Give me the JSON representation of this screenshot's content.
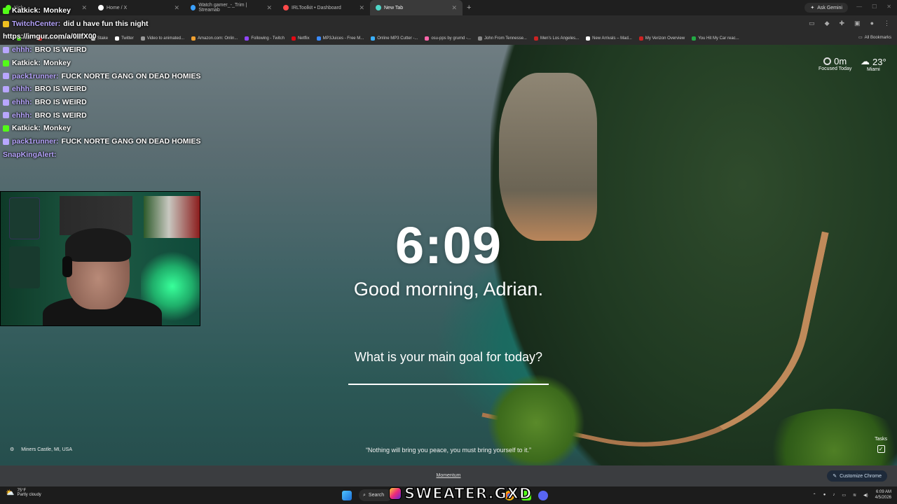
{
  "browser": {
    "tabs": [
      {
        "label": "Kick",
        "color": "#53fc18",
        "active": false
      },
      {
        "label": "Home / X",
        "color": "#ffffff",
        "active": false
      },
      {
        "label": "Watch gamer_-_Trim | Streamab",
        "color": "#3aa0ff",
        "active": false
      },
      {
        "label": "IRLToolkit • Dashboard",
        "color": "#ff4a4a",
        "active": false
      },
      {
        "label": "New Tab",
        "color": "#4fd6c8",
        "active": true
      }
    ],
    "new_tab_symbol": "+",
    "ask_gemini": "Ask Gemini",
    "bookmarks": [
      {
        "label": "Kick",
        "color": "#53fc18"
      },
      {
        "label": "Subscriptions - You...",
        "color": "#ff3b3b"
      },
      {
        "label": "Stake",
        "color": "#dddddd"
      },
      {
        "label": "Twitter",
        "color": "#ffffff"
      },
      {
        "label": "Video to animated...",
        "color": "#999999"
      },
      {
        "label": "Amazon.com: Onlin...",
        "color": "#f0a030"
      },
      {
        "label": "Following - Twitch",
        "color": "#9146ff"
      },
      {
        "label": "Netflix",
        "color": "#e50914"
      },
      {
        "label": "MP3Juices - Free M...",
        "color": "#3a8bff"
      },
      {
        "label": "Online MP3 Cutter -...",
        "color": "#3ab0ff"
      },
      {
        "label": "osu-pps by grumd -...",
        "color": "#ff66aa"
      },
      {
        "label": "John From Tennesse...",
        "color": "#888888"
      },
      {
        "label": "Men's Los Angeles...",
        "color": "#cc2222"
      },
      {
        "label": "New Arrivals – Mad...",
        "color": "#ffffff"
      },
      {
        "label": "My Verizon Overview",
        "color": "#cc2222"
      },
      {
        "label": "You Hit My Car reac...",
        "color": "#22aa44"
      }
    ],
    "all_bookmarks": "All Bookmarks"
  },
  "momentum": {
    "time": "6:09",
    "greeting": "Good morning, Adrian.",
    "goal_question": "What is your main goal for today?",
    "goal_value": "",
    "quote": "“Nothing will bring you peace, you must bring yourself to it.”",
    "location": "Miners Castle, MI, USA",
    "tasks_label": "Tasks",
    "focus_value": "0m",
    "focus_label": "Focused Today",
    "temperature": "23°",
    "city": "Miami",
    "footer_link": "Momentum",
    "customize": "Customize Chrome"
  },
  "chat": [
    {
      "user": "Katkick",
      "message": "Monkey",
      "badge_color": "#53fc18",
      "user_color": "#ffffff"
    },
    {
      "user": "TwitchCenter",
      "message": "did u have fun this night",
      "badge_color": "#f0c020",
      "user_color": "#b8a6ff"
    },
    {
      "user": "",
      "message": "https://imgur.com/a/0IIfX00",
      "badge_color": "",
      "user_color": "#ffffff"
    },
    {
      "user": "ehhh",
      "message": "BRO IS WEIRD",
      "badge_color": "#b8a6ff",
      "user_color": "#b8a6ff"
    },
    {
      "user": "Katkick",
      "message": "Monkey",
      "badge_color": "#53fc18",
      "user_color": "#ffffff"
    },
    {
      "user": "pack1runner",
      "message": "FUCK NORTE GANG ON DEAD HOMIES",
      "badge_color": "#b8a6ff",
      "user_color": "#b8a6ff"
    },
    {
      "user": "ehhh",
      "message": "BRO IS WEIRD",
      "badge_color": "#b8a6ff",
      "user_color": "#b8a6ff"
    },
    {
      "user": "ehhh",
      "message": "BRO IS WEIRD",
      "badge_color": "#b8a6ff",
      "user_color": "#b8a6ff"
    },
    {
      "user": "ehhh",
      "message": "BRO IS WEIRD",
      "badge_color": "#b8a6ff",
      "user_color": "#b8a6ff"
    },
    {
      "user": "Katkick",
      "message": "Monkey",
      "badge_color": "#53fc18",
      "user_color": "#ffffff"
    },
    {
      "user": "pack1runner",
      "message": "FUCK NORTE GANG ON DEAD HOMIES",
      "badge_color": "#b8a6ff",
      "user_color": "#b8a6ff"
    },
    {
      "user": "SnapKingAlert",
      "message": "",
      "badge_color": "",
      "user_color": "#b8a6ff"
    }
  ],
  "taskbar": {
    "weather_temp": "75°F",
    "weather_desc": "Partly cloudy",
    "search": "Search",
    "time": "6:09 AM",
    "date": "4/5/2026"
  },
  "watermark": "SWEATER.GXD"
}
